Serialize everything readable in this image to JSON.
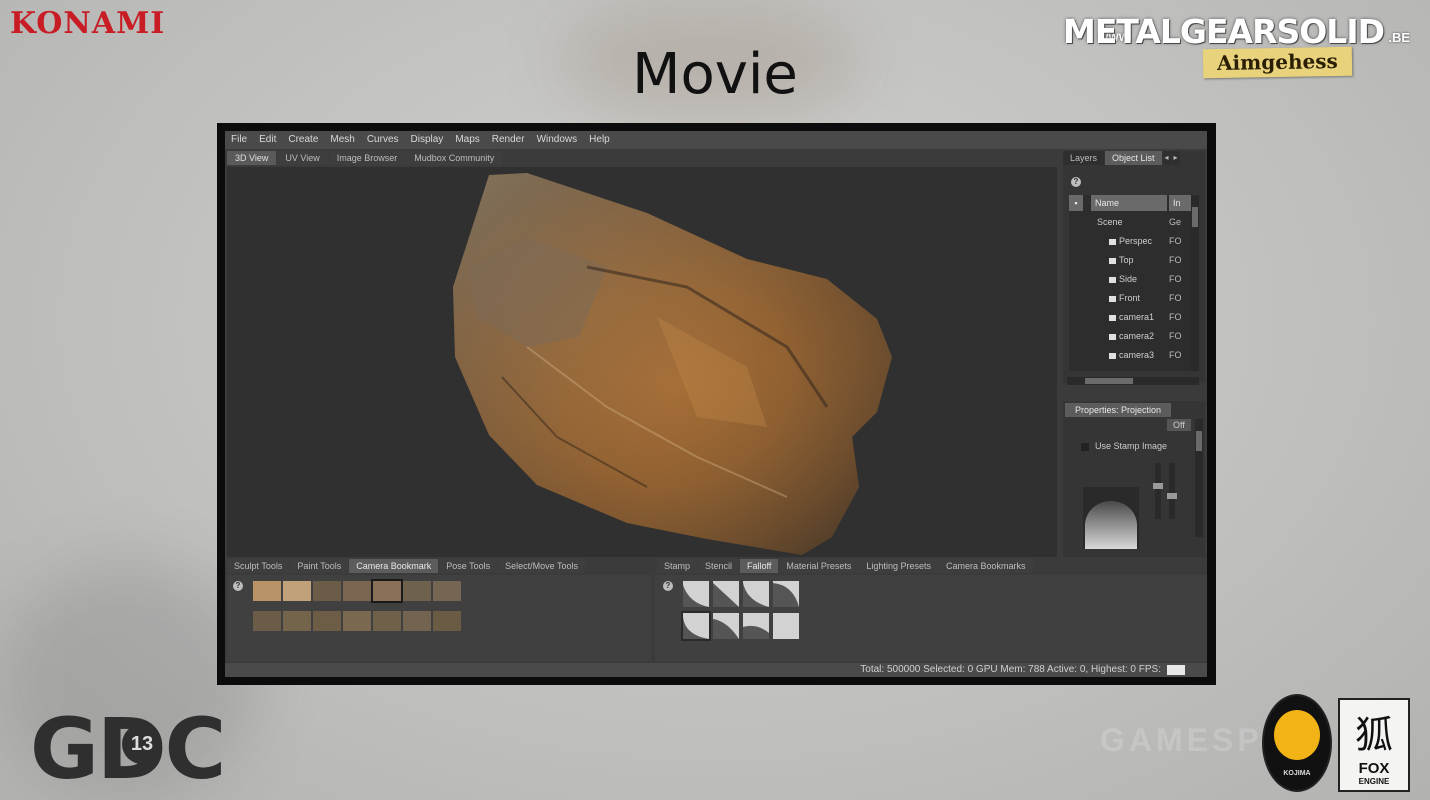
{
  "slide": {
    "title": "Movie",
    "konami": "KONAMI",
    "mgs_www": "WWW.",
    "mgs_title": "METALGEARSOLID",
    "mgs_be": ".BE",
    "mgs_tag": "Aimgehess",
    "gdc_text": "GDC",
    "gdc_year": "13",
    "kojima": "KOJIMA",
    "fox_kanji": "狐",
    "fox_text": "FOX",
    "fox_sub": "ENGINE",
    "watermark": "GAMESPOT"
  },
  "app": {
    "menu": [
      "File",
      "Edit",
      "Create",
      "Mesh",
      "Curves",
      "Display",
      "Maps",
      "Render",
      "Windows",
      "Help"
    ],
    "view_tabs": [
      "3D View",
      "UV View",
      "Image Browser",
      "Mudbox Community"
    ],
    "active_view_tab": 0,
    "right_tabs": [
      "Layers",
      "Object List"
    ],
    "active_right_tab": 1,
    "outliner": {
      "col_name": "Name",
      "col_type": "In",
      "rows": [
        {
          "name": "Scene",
          "type": "Ge"
        },
        {
          "name": "Perspec",
          "type": "FO"
        },
        {
          "name": "Top",
          "type": "FO"
        },
        {
          "name": "Side",
          "type": "FO"
        },
        {
          "name": "Front",
          "type": "FO"
        },
        {
          "name": "camera1",
          "type": "FO"
        },
        {
          "name": "camera2",
          "type": "FO"
        },
        {
          "name": "camera3",
          "type": "FO"
        }
      ]
    },
    "properties": {
      "tab": "Properties: Projection",
      "off_value": "Off",
      "use_stamp_label": "Use Stamp Image"
    },
    "left_bottom_tabs": [
      "Sculpt Tools",
      "Paint Tools",
      "Camera Bookmark",
      "Pose Tools",
      "Select/Move Tools"
    ],
    "active_left_bottom_tab": 2,
    "right_bottom_tabs": [
      "Stamp",
      "Stencil",
      "Falloff",
      "Material Presets",
      "Lighting Presets",
      "Camera Bookmarks"
    ],
    "active_right_bottom_tab": 2,
    "status": "Total: 500000  Selected: 0 GPU Mem: 788  Active: 0, Highest: 0  FPS:"
  }
}
